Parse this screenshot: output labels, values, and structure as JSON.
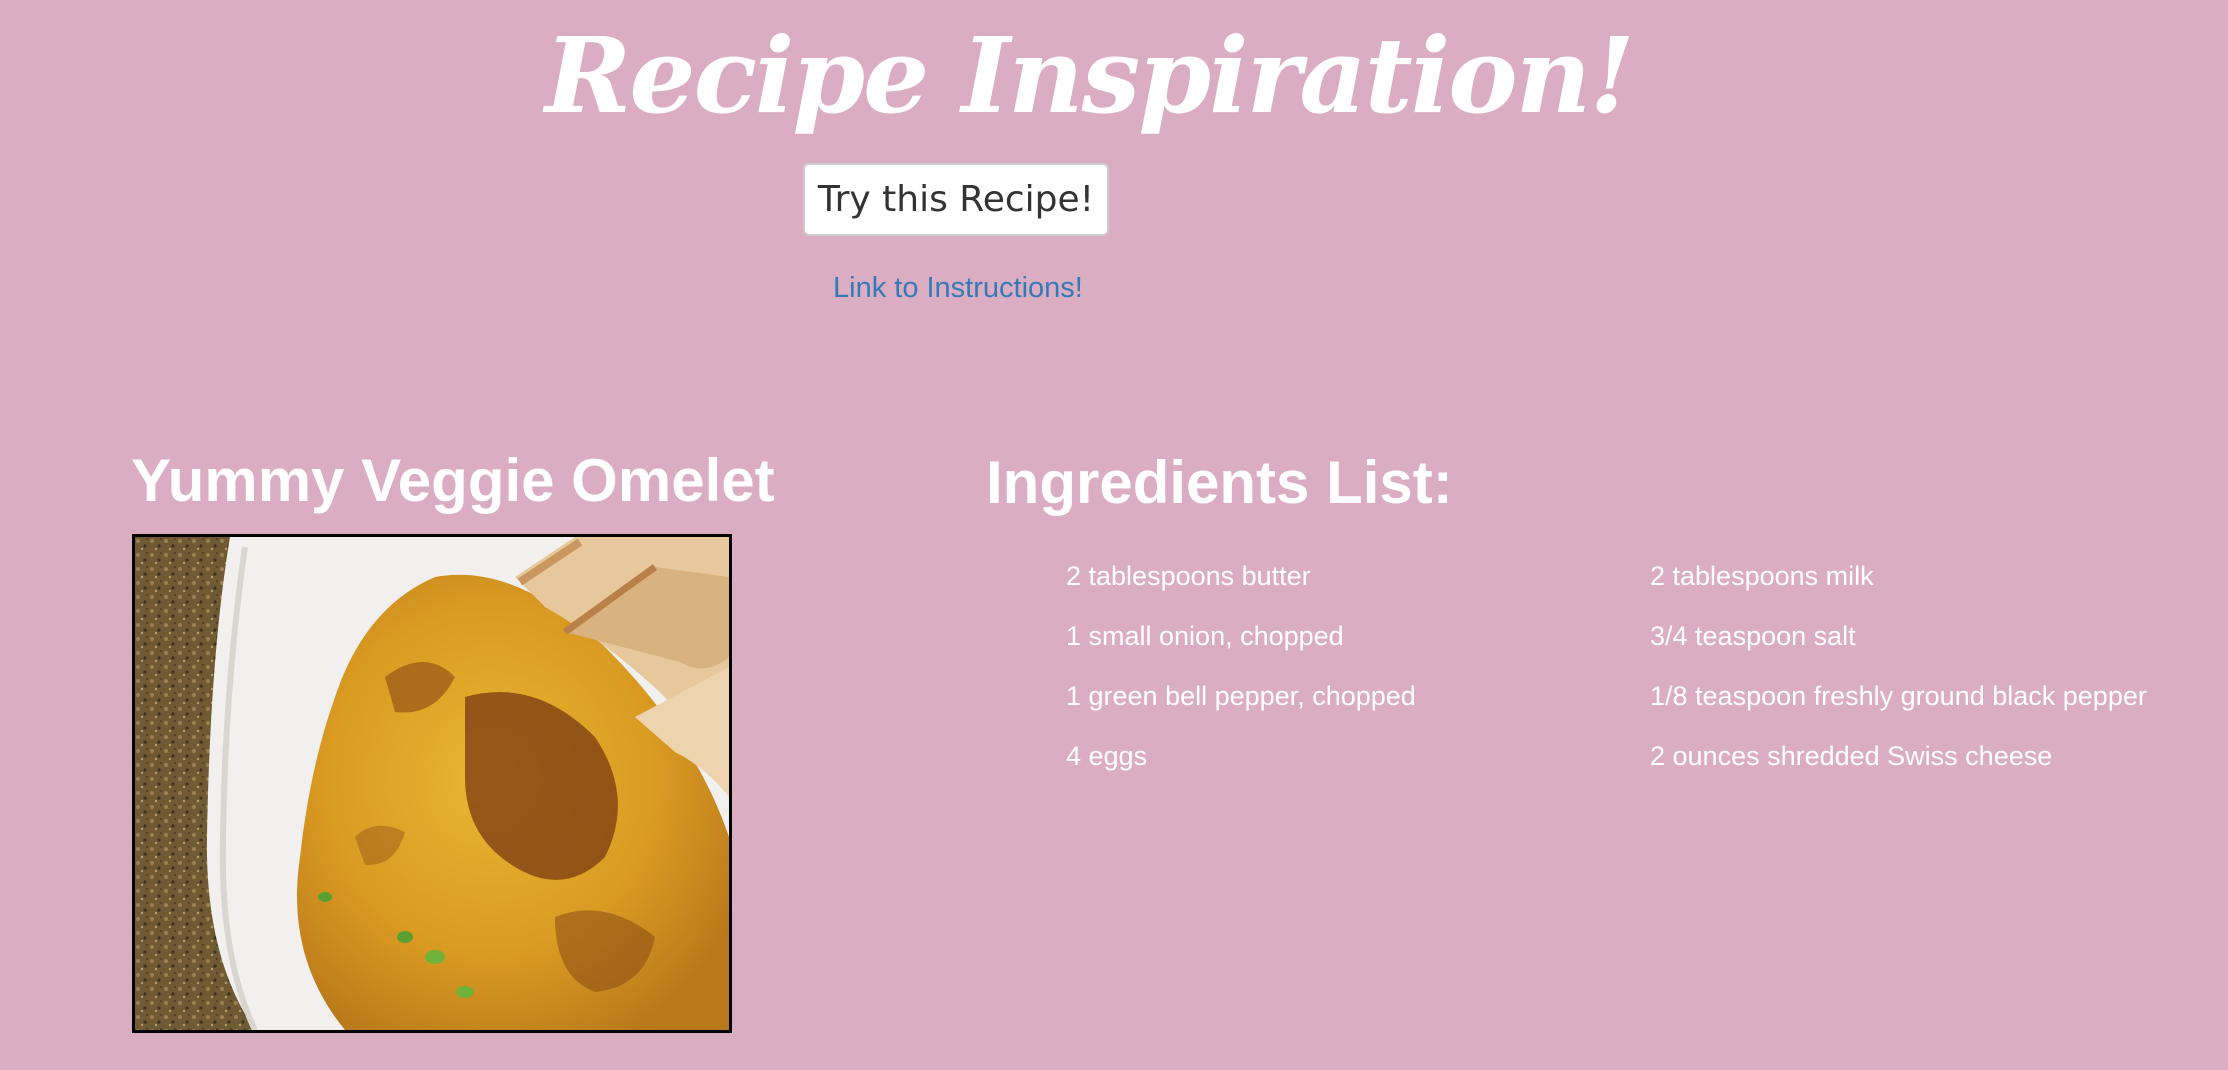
{
  "header": {
    "title": "Recipe Inspiration!",
    "try_button_label": "Try this Recipe!",
    "instructions_link_label": "Link to Instructions!"
  },
  "recipe": {
    "name": "Yummy Veggie Omelet",
    "photo_icon": "omelet-photo"
  },
  "ingredients": {
    "heading": "Ingredients List:",
    "left_column": [
      "2 tablespoons butter",
      "1 small onion, chopped",
      "1 green bell pepper, chopped",
      "4 eggs"
    ],
    "right_column": [
      "2 tablespoons milk",
      "3/4 teaspoon salt",
      "1/8 teaspoon freshly ground black pepper",
      "2 ounces shredded Swiss cheese"
    ]
  },
  "colors": {
    "background": "#dbadc2",
    "text": "#ffffff",
    "link": "#337ab7",
    "button_background": "#ffffff",
    "button_text": "#333333"
  }
}
